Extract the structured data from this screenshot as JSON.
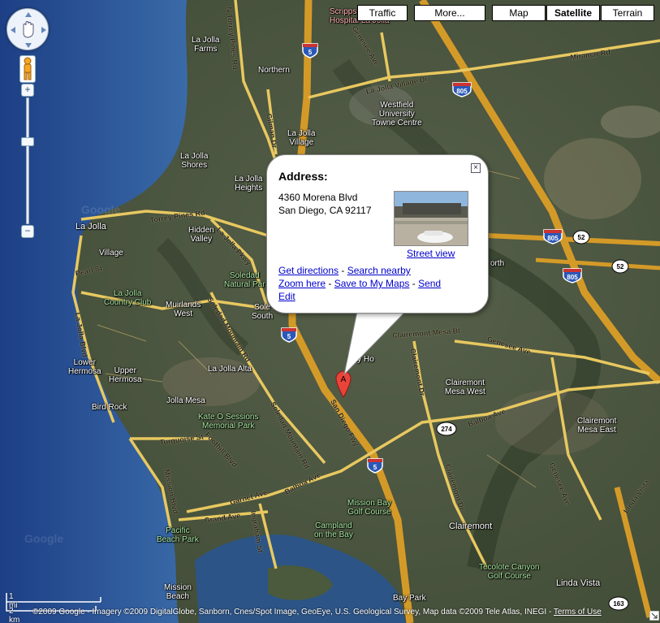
{
  "map_types": {
    "traffic": "Traffic",
    "more": "More...",
    "map": "Map",
    "satellite": "Satellite",
    "terrain": "Terrain",
    "selected": "satellite"
  },
  "controls": {
    "zoom_in": "+",
    "zoom_out": "−"
  },
  "places": {
    "scripps": "Scripps\nHospital La Jolla",
    "la_jolla_farms": "La Jolla\nFarms",
    "northern": "Northern",
    "la_jolla_village": "La Jolla\nVillage",
    "westfield": "Westfield\nUniversity\nTowne Centre",
    "la_jolla_shores": "La Jolla\nShores",
    "la_jolla_heights": "La Jolla\nHeights",
    "la_jolla": "La Jolla",
    "village": "Village",
    "hidden_valley": "Hidden\nValley",
    "la_jolla_cc": "La Jolla\nCountry Club",
    "muirlands_west": "Muirlands\nWest",
    "soledad_natural_park": "Soledad\nNatural Par",
    "soledad_south": "Sole\nSouth",
    "lower_hermosa": "Lower\nHermosa",
    "upper_hermosa": "Upper\nHermosa",
    "la_jolla_alta": "La Jolla Alta",
    "jolla_mesa": "Jolla Mesa",
    "bird_rock": "Bird Rock",
    "kate_sessions": "Kate O Sessions\nMemorial Park",
    "bay_ho": "Bay Ho",
    "north": "orth",
    "clairemont_mesa_west": "Clairemont\nMesa West",
    "clairemont_mesa_east": "Clairemont\nMesa East",
    "clairemont": "Clairemont",
    "mission_bay_golf": "Mission Bay\nGolf Course",
    "campland": "Campland\non the Bay",
    "pacific_beach_park": "Pacific\nBeach Park",
    "mission_beach": "Mission\nBeach",
    "tecolote": "Tecolote Canyon\nGolf Course",
    "linda_vista": "Linda Vista",
    "bay_park": "Bay Park"
  },
  "roads": {
    "n_torrey_pines": "N Torrey Pines Rd",
    "genesee_top": "Genesee Ave",
    "miramar": "Miramar Rd",
    "la_jolla_village_dr": "La Jolla Village Dr",
    "gilman": "Gilman Dr",
    "torrey_pines": "Torrey Pines Rd",
    "la_jolla_pkwy": "La Jolla Pkwy",
    "pearl": "Pearl St",
    "la_jolla_blvd": "La Jolla Blvd",
    "soledad_mtn_top": "Soledad Mountain Rd",
    "soledad_mtn_bottom": "Soledad Mountain Rd",
    "turquoise": "Turquoise St",
    "foothill": "Foothill Blvd",
    "mission_blvd": "Mission Blvd",
    "garnet": "Garnet Ave",
    "balboa_left": "Balboa Ave",
    "grand": "Grand Ave",
    "ingraham": "Ingraham St",
    "san_diego_fwy": "San Diego Fwy",
    "clairemont_mesa": "Clairemont Mesa Bl",
    "clairemont_dr_top": "Clairemont Dr",
    "genesee_right": "Genesee Ave",
    "balboa_right": "Balboa Ave",
    "clairemont_dr_bottom": "Clairemont Dr",
    "genesee_bottom": "Genesee Ave",
    "linda_vista_rd": "Linda Vista"
  },
  "shields": {
    "i5_top": "5",
    "i805_top": "805",
    "i805_mid": "805",
    "i805_low": "805",
    "r52_a": "52",
    "r52_b": "52",
    "i5_mid": "5",
    "r274": "274",
    "i5_low": "5",
    "r163": "163"
  },
  "popup": {
    "title": "Address:",
    "address_line1": "4360 Morena Blvd",
    "address_line2": "San Diego, CA 92117",
    "street_view": "Street view",
    "get_directions": "Get directions",
    "search_nearby": "Search nearby",
    "zoom_here": "Zoom here",
    "save_to_my_maps": "Save to My Maps",
    "send": "Send",
    "edit": "Edit",
    "sep": " - "
  },
  "marker": {
    "letter": "A"
  },
  "scale": {
    "miles": "1 mi",
    "km": "2 km"
  },
  "footer": {
    "attribution": "©2009 Google - Imagery ©2009 DigitalGlobe, Sanborn, Cnes/Spot Image, GeoEye, U.S. Geological Survey, Map data ©2009 Tele Atlas, INEGI - ",
    "terms": "Terms of Use"
  },
  "watermark": "Google",
  "colors": {
    "road": "#e8c860",
    "highway": "#e0a830",
    "ocean": "#2a4e8c",
    "land": "#4b5a3c"
  }
}
